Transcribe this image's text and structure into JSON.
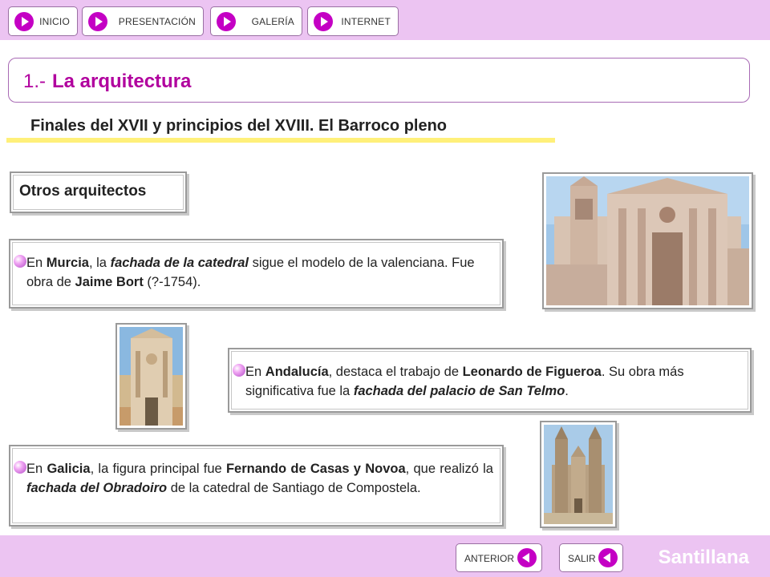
{
  "nav": {
    "items": [
      {
        "label": "INICIO"
      },
      {
        "label": "PRESENTACIÓN"
      },
      {
        "label": "GALERÍA"
      },
      {
        "label": "INTERNET"
      }
    ]
  },
  "header": {
    "number": "1.-",
    "title": "La arquitectura"
  },
  "subtitle": "Finales del XVII y principios del XVIII. El Barroco pleno",
  "section_title": "Otros arquitectos",
  "paragraphs": {
    "murcia": {
      "t1": "En ",
      "b1": "Murcia",
      "t2": ", la ",
      "bi1": "fachada de la catedral",
      "t3": "  sigue el modelo de la valenciana. Fue obra de ",
      "b2": "Jaime Bort",
      "t4": " (?-1754)."
    },
    "andalucia": {
      "t1": "En ",
      "b1": "Andalucía",
      "t2": ", destaca el trabajo de ",
      "b2": "Leonardo de Figueroa",
      "t3": ". Su obra más significativa fue la ",
      "bi1": "fachada del palacio de San Telmo",
      "t4": "."
    },
    "galicia": {
      "t1": "En ",
      "b1": "Galicia",
      "t2": ", la figura principal fue ",
      "b2": "Fernando de Casas y Novoa",
      "t3": ", que realizó la ",
      "bi1": "fachada del Obradoiro",
      "t4": " de la catedral de Santiago de Compostela."
    }
  },
  "footer": {
    "prev_label": "ANTERIOR",
    "exit_label": "SALIR",
    "brand": "Santillana"
  },
  "colors": {
    "bar": "#ecc4f2",
    "accent": "#b1009e",
    "arrow": "#c400c4",
    "underline": "#fff07a"
  }
}
